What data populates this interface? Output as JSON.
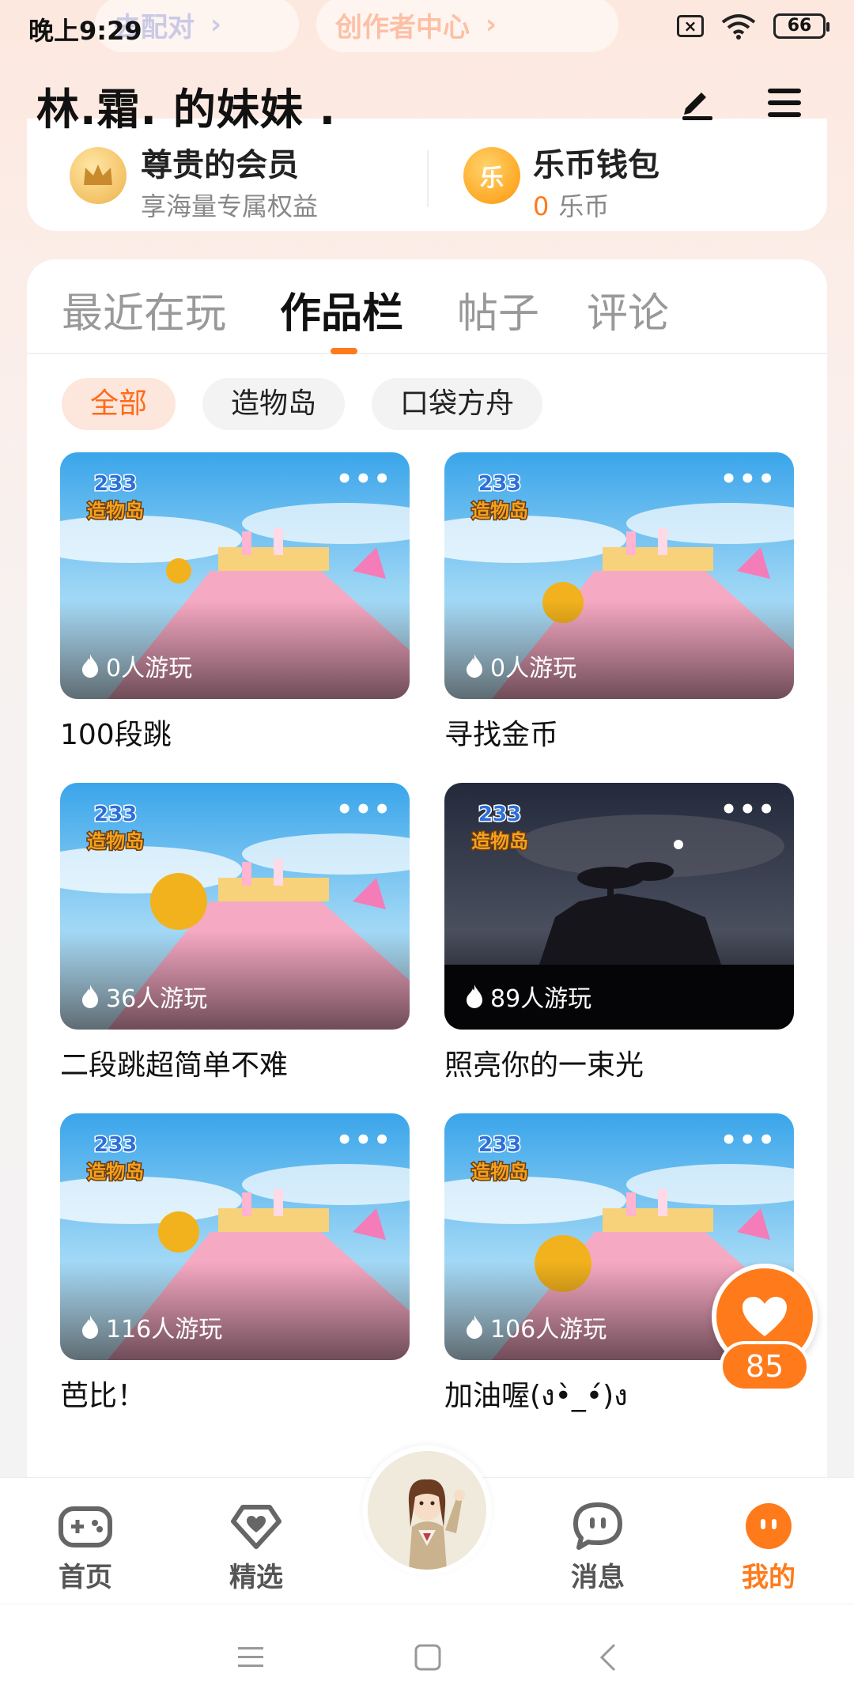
{
  "status_bar": {
    "time": "晚上9:29",
    "battery": "66"
  },
  "ghost_pills": {
    "pair": "去配对",
    "creator": "创作者中心"
  },
  "header": {
    "username": "林.霜. 的妹妹 ."
  },
  "member": {
    "vip_title": "尊贵的会员",
    "vip_sub": "享海量专属权益",
    "wallet_title": "乐币钱包",
    "wallet_coin_glyph": "乐",
    "wallet_amount": "0",
    "wallet_unit": "乐币"
  },
  "tabs": [
    "最近在玩",
    "作品栏",
    "帖子",
    "评论"
  ],
  "filters": [
    "全部",
    "造物岛",
    "口袋方舟"
  ],
  "works": [
    {
      "title": "100段跳",
      "plays": "0人游玩",
      "scene": "day"
    },
    {
      "title": "寻找金币",
      "plays": "0人游玩",
      "scene": "day"
    },
    {
      "title": "二段跳超简单不难",
      "plays": "36人游玩",
      "scene": "day"
    },
    {
      "title": "照亮你的一束光",
      "plays": "89人游玩",
      "scene": "night"
    },
    {
      "title": "芭比！",
      "plays": "116人游玩",
      "scene": "day"
    },
    {
      "title": "加油喔(ง•̀_•́)ง",
      "plays": "106人游玩",
      "scene": "day"
    }
  ],
  "badge_text": {
    "top": "233",
    "bottom": "造物岛"
  },
  "more_label": "•••",
  "like": {
    "count": "85"
  },
  "nav": {
    "home": "首页",
    "featured": "精选",
    "messages": "消息",
    "mine": "我的"
  },
  "colors": {
    "accent": "#ff7a1a",
    "chip_active_bg": "#fde6dc"
  }
}
